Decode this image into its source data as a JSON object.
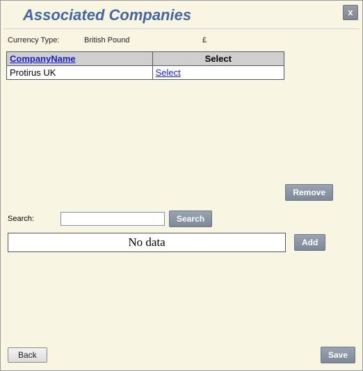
{
  "title": "Associated Companies",
  "close_label": "x",
  "currency": {
    "label": "Currency Type:",
    "value": "British Pound",
    "symbol": "£"
  },
  "companies_table": {
    "headers": {
      "name": "CompanyName",
      "select": "Select"
    },
    "rows": [
      {
        "name": "Protirus UK",
        "select_label": "Select"
      }
    ]
  },
  "remove_label": "Remove",
  "search": {
    "label": "Search:",
    "value": "",
    "placeholder": "",
    "button": "Search"
  },
  "results": {
    "empty_text": "No data"
  },
  "add_label": "Add",
  "footer": {
    "back": "Back",
    "save": "Save"
  }
}
